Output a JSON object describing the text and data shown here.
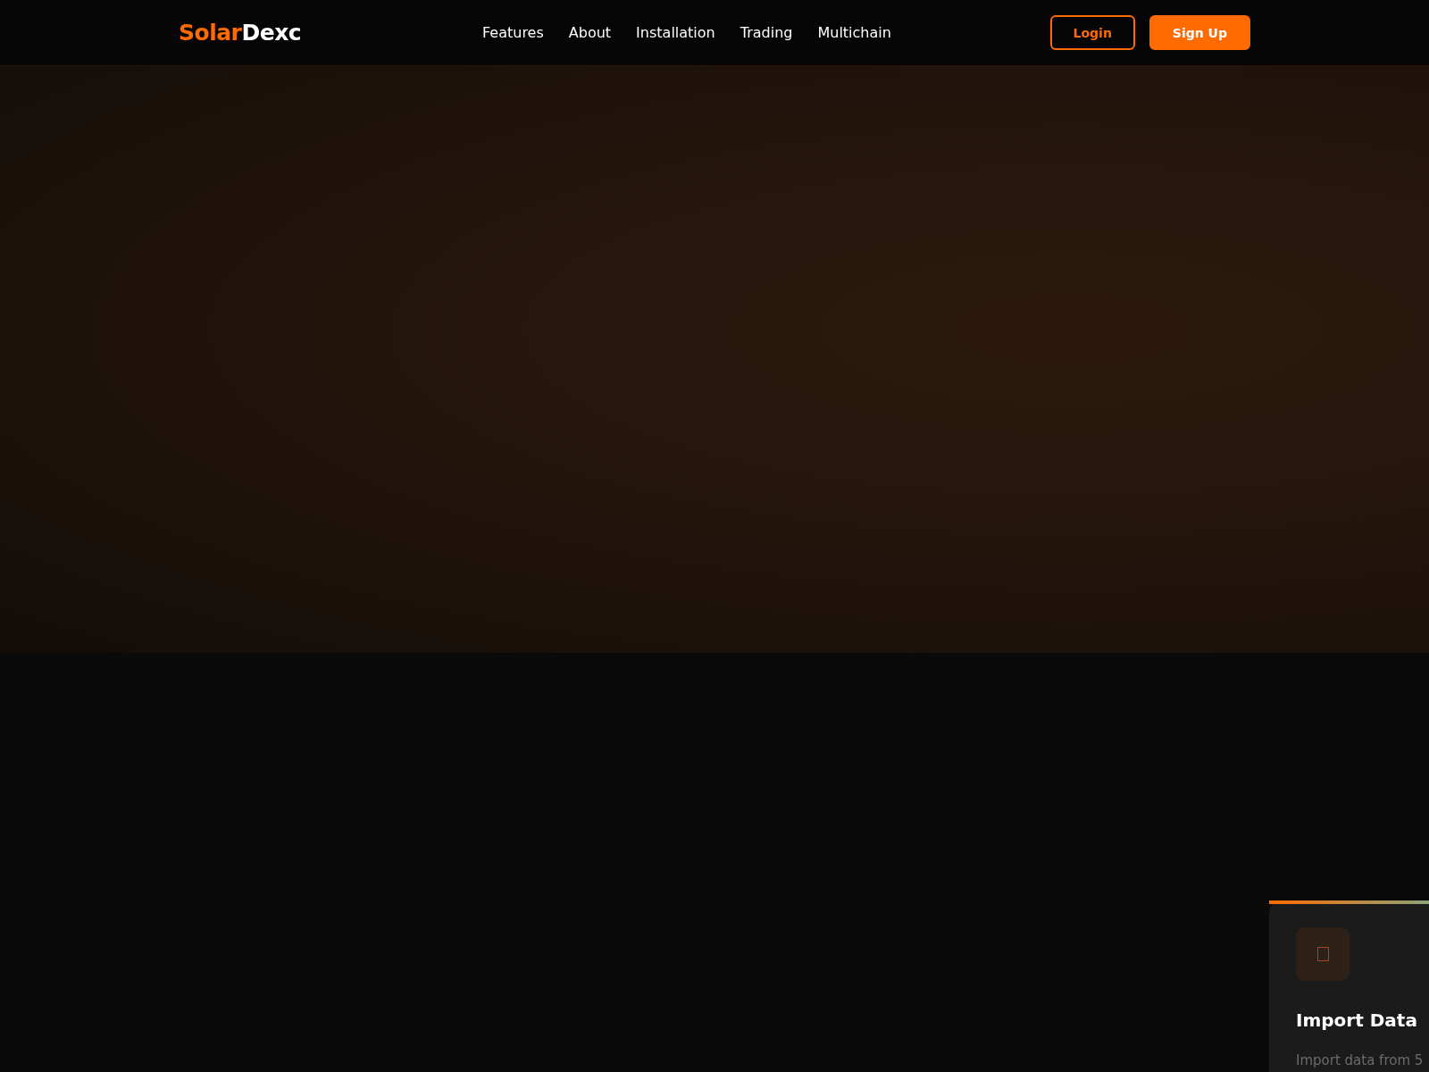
{
  "header": {
    "logo": {
      "first": "Solar",
      "second": "Dexc"
    },
    "nav": [
      "Features",
      "About",
      "Installation",
      "Trading",
      "Multichain"
    ],
    "buttons": [
      {
        "label": "Login",
        "kind": "outline"
      },
      {
        "label": "Sign Up",
        "kind": "filled"
      }
    ]
  },
  "features": [
    {
      "title": "Import Data",
      "description": "Import data from 5"
    }
  ]
}
